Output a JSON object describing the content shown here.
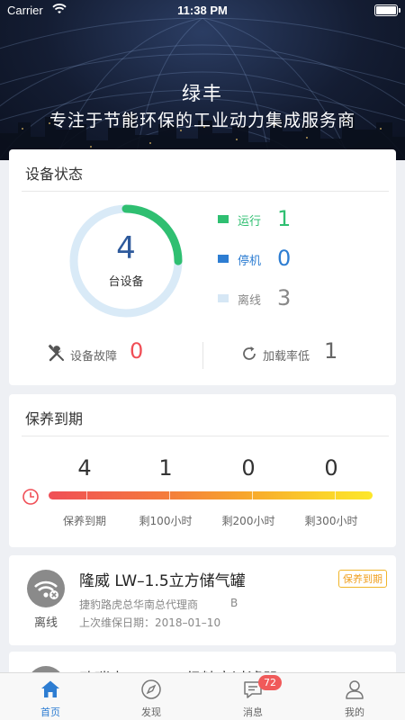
{
  "status_bar": {
    "carrier": "Carrier",
    "time": "11:38 PM"
  },
  "header": {
    "brand": "绿丰",
    "slogan": "专注于节能环保的工业动力集成服务商"
  },
  "device_status": {
    "title": "设备状态",
    "total": "4",
    "total_label": "台设备",
    "legend": [
      {
        "label": "运行",
        "value": "1",
        "color": "#2fbf71"
      },
      {
        "label": "停机",
        "value": "0",
        "color": "#2d7dd2"
      },
      {
        "label": "离线",
        "value": "3",
        "color": "#d6e7f5"
      }
    ],
    "running_fraction": 0.25,
    "fault_label": "设备故障",
    "fault_value": "0",
    "lowload_label": "加载率低",
    "lowload_value": "1"
  },
  "maintenance": {
    "title": "保养到期",
    "items": [
      {
        "value": "4",
        "label": "保养到期",
        "color": "#f04e56"
      },
      {
        "value": "1",
        "label": "剩100小时",
        "color": "#f6a623"
      },
      {
        "value": "0",
        "label": "剩200小时",
        "color": "#f6b623"
      },
      {
        "value": "0",
        "label": "剩300小时",
        "color": "#f6c623"
      }
    ]
  },
  "devices": [
    {
      "state": "离线",
      "name": "隆威 LW–1.5立方储气罐",
      "badge": "保养到期",
      "location": "捷豹路虎总华南总代理商",
      "location_tag": "B",
      "last_service": "上次维保日期：2018–01–10"
    },
    {
      "name": "欧瑞克 OMK–M级精密过滤器"
    }
  ],
  "tabbar": {
    "tabs": [
      {
        "label": "首页"
      },
      {
        "label": "发现"
      },
      {
        "label": "消息",
        "badge": "72"
      },
      {
        "label": "我的"
      }
    ]
  }
}
